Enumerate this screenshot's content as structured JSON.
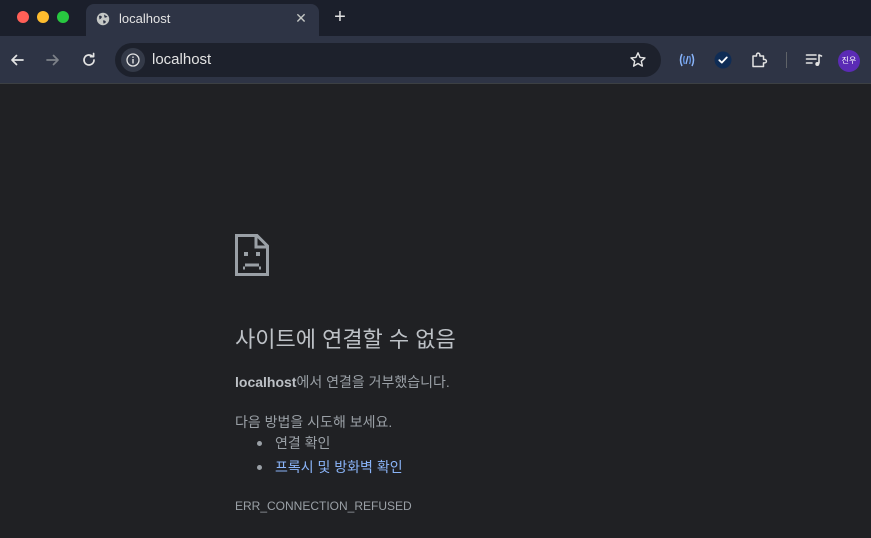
{
  "tab": {
    "title": "localhost",
    "close_glyph": "✕"
  },
  "newtab_glyph": "+",
  "omnibox": {
    "url": "localhost"
  },
  "profile": {
    "initials": "진우",
    "color": "#5b2bb5"
  },
  "error": {
    "heading": "사이트에 연결할 수 없음",
    "host": "localhost",
    "message_suffix": "에서 연결을 거부했습니다.",
    "try_label": "다음 방법을 시도해 보세요.",
    "suggestions": [
      "연결 확인",
      "프록시 및 방화벽 확인"
    ],
    "code": "ERR_CONNECTION_REFUSED"
  },
  "icons": {
    "back": "arrow-left-icon",
    "forward": "arrow-right-icon",
    "reload": "reload-icon",
    "info": "info-icon",
    "star": "star-icon",
    "extension_wireless": "wireless-icon",
    "extension_check": "check-badge-icon",
    "extensions": "puzzle-icon",
    "media": "media-queue-icon",
    "sad_page": "sad-page-icon"
  },
  "colors": {
    "link": "#8ab4f8",
    "background": "#202124",
    "toolbar": "#2e3445"
  }
}
